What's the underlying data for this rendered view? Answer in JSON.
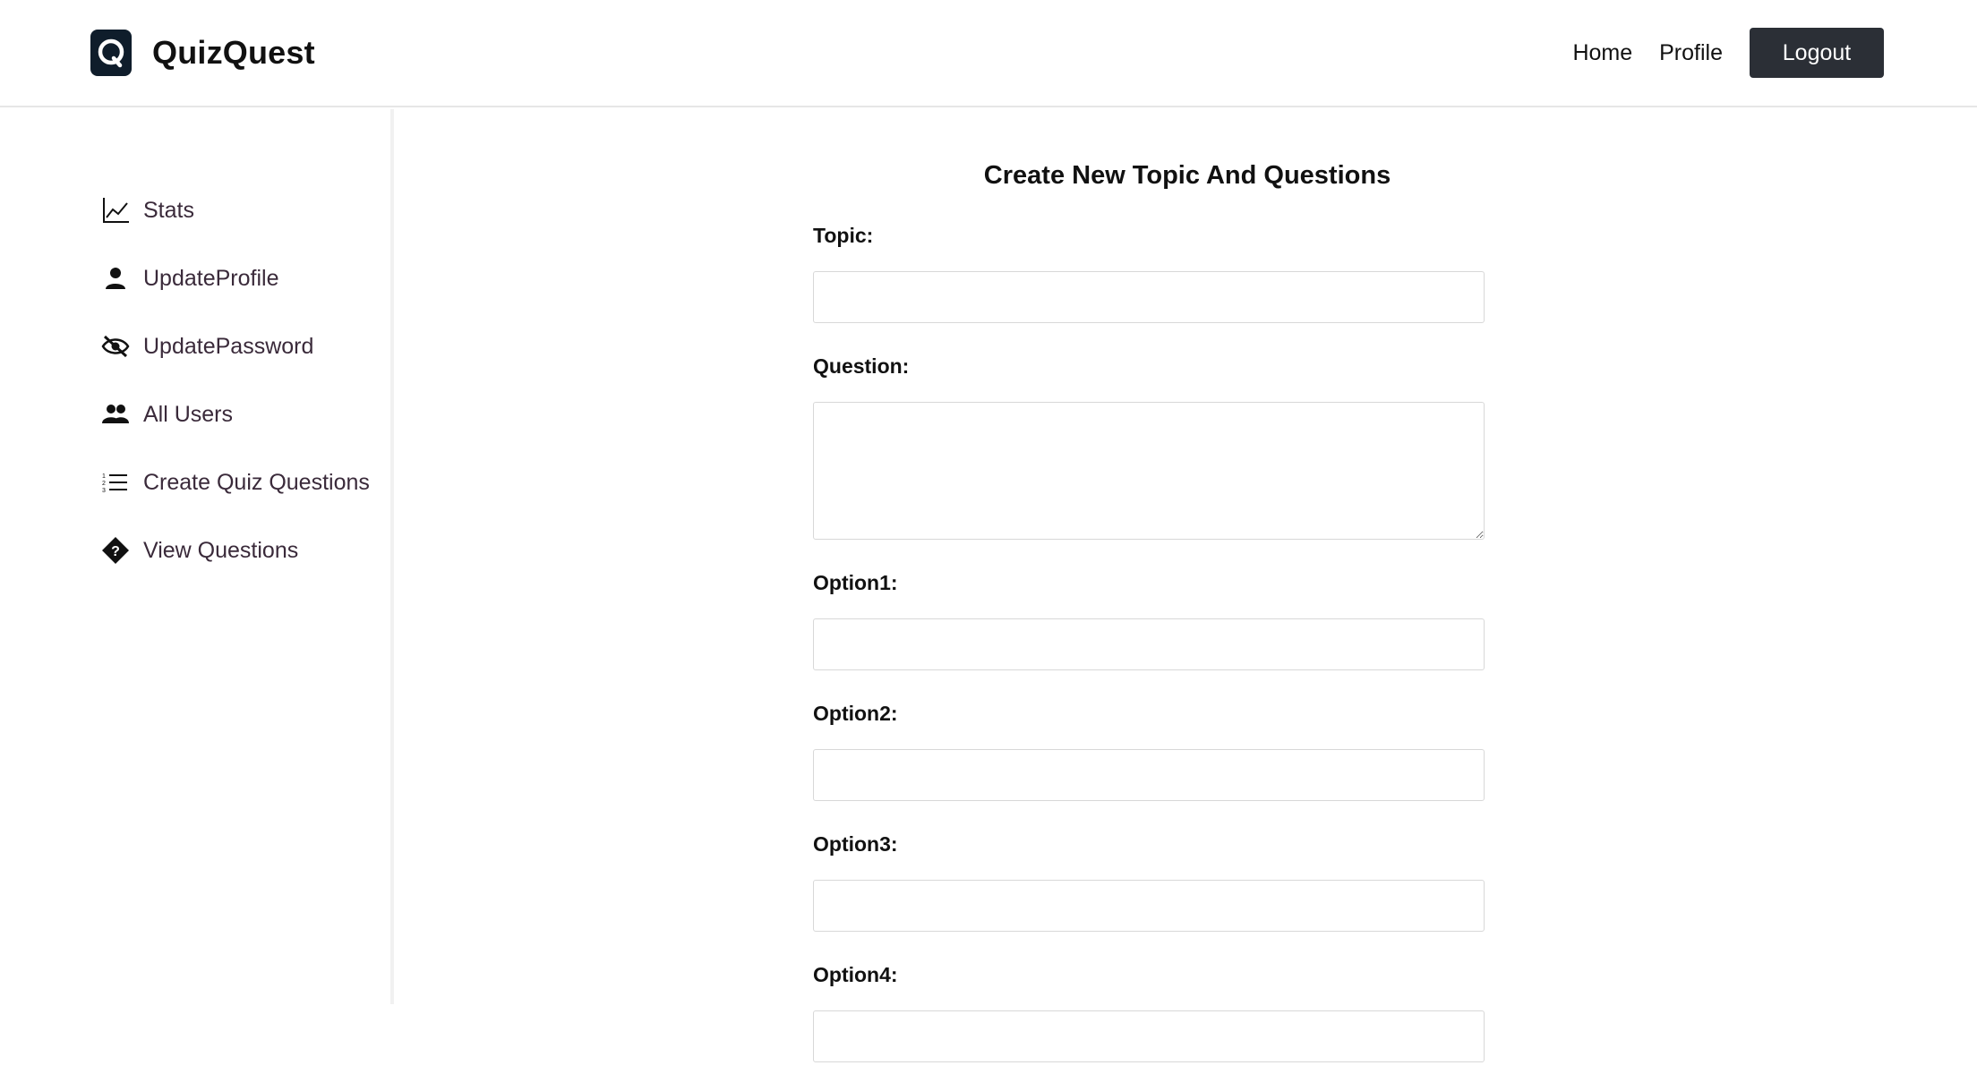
{
  "app": {
    "name": "QuizQuest"
  },
  "header": {
    "nav": [
      "Home",
      "Profile"
    ],
    "logout_label": "Logout"
  },
  "sidebar": {
    "items": [
      {
        "label": "Stats",
        "icon": "line-chart-icon"
      },
      {
        "label": "UpdateProfile",
        "icon": "person-icon"
      },
      {
        "label": "UpdatePassword",
        "icon": "eye-slash-icon"
      },
      {
        "label": "All Users",
        "icon": "people-icon"
      },
      {
        "label": "Create Quiz Questions",
        "icon": "list-icon"
      },
      {
        "label": "View Questions",
        "icon": "question-diamond-icon"
      }
    ]
  },
  "main": {
    "title": "Create New Topic And Questions",
    "fields": {
      "topic": {
        "label": "Topic:",
        "value": ""
      },
      "question": {
        "label": "Question:",
        "value": ""
      },
      "option1": {
        "label": "Option1:",
        "value": ""
      },
      "option2": {
        "label": "Option2:",
        "value": ""
      },
      "option3": {
        "label": "Option3:",
        "value": ""
      },
      "option4": {
        "label": "Option4:",
        "value": ""
      }
    }
  },
  "colors": {
    "logo_bg": "#0f1d2b",
    "logout_bg": "#2b2f36",
    "sidebar_text": "#3a2a3a"
  }
}
